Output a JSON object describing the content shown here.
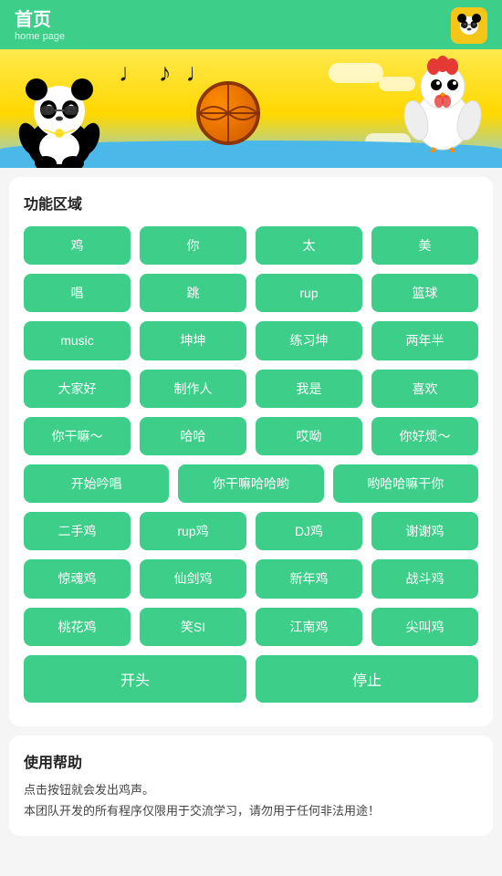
{
  "header": {
    "title": "首页",
    "subtitle": "home page"
  },
  "banner": {
    "alt": "Cool panda with sunglasses, basketball and chicken"
  },
  "function_area": {
    "title": "功能区域",
    "rows": [
      [
        "鸡",
        "你",
        "太",
        "美"
      ],
      [
        "唱",
        "跳",
        "rup",
        "篮球"
      ],
      [
        "music",
        "坤坤",
        "练习坤",
        "两年半"
      ],
      [
        "大家好",
        "制作人",
        "我是",
        "喜欢"
      ],
      [
        "你干嘛～",
        "哈哈",
        "哎呦",
        "你好烦～"
      ]
    ],
    "row3_special": [
      "开始吟唱",
      "你干嘛哈哈哟",
      "哟哈哈嘛干你"
    ],
    "row4": [
      "二手鸡",
      "rup鸡",
      "DJ鸡",
      "谢谢鸡"
    ],
    "row5": [
      "惊魂鸡",
      "仙剑鸡",
      "新年鸡",
      "战斗鸡"
    ],
    "row6": [
      "桃花鸡",
      "笑SI",
      "江南鸡",
      "尖叫鸡"
    ],
    "actions": [
      "开头",
      "停止"
    ]
  },
  "help": {
    "title": "使用帮助",
    "lines": [
      "点击按钮就会发出鸡声。",
      "本团队开发的所有程序仅限用于交流学习，请勿用于任何非法用途！"
    ]
  }
}
